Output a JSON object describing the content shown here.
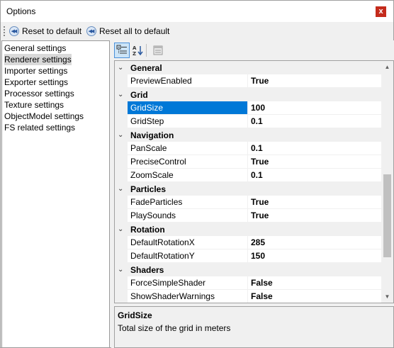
{
  "window": {
    "title": "Options",
    "close_glyph": "x"
  },
  "toolbar": {
    "reset_default": "Reset to default",
    "reset_all_default": "Reset all to default"
  },
  "left_list": [
    {
      "label": "General settings",
      "selected": false
    },
    {
      "label": "Renderer settings",
      "selected": true
    },
    {
      "label": "Importer settings",
      "selected": false
    },
    {
      "label": "Exporter settings",
      "selected": false
    },
    {
      "label": "Processor settings",
      "selected": false
    },
    {
      "label": "Texture settings",
      "selected": false
    },
    {
      "label": "ObjectModel settings",
      "selected": false
    },
    {
      "label": "FS related settings",
      "selected": false
    }
  ],
  "grid_toolbar": {
    "categorized_icon": "categorized-view-icon",
    "alphabetical_icon": "alphabetical-sort-icon",
    "property_pages_icon": "property-pages-icon",
    "active": "categorized"
  },
  "property_grid": [
    {
      "type": "category",
      "label": "General"
    },
    {
      "type": "property",
      "name": "PreviewEnabled",
      "value": "True"
    },
    {
      "type": "category",
      "label": "Grid"
    },
    {
      "type": "property",
      "name": "GridSize",
      "value": "100",
      "selected": true
    },
    {
      "type": "property",
      "name": "GridStep",
      "value": "0.1"
    },
    {
      "type": "category",
      "label": "Navigation"
    },
    {
      "type": "property",
      "name": "PanScale",
      "value": "0.1"
    },
    {
      "type": "property",
      "name": "PreciseControl",
      "value": "True"
    },
    {
      "type": "property",
      "name": "ZoomScale",
      "value": "0.1"
    },
    {
      "type": "category",
      "label": "Particles"
    },
    {
      "type": "property",
      "name": "FadeParticles",
      "value": "True"
    },
    {
      "type": "property",
      "name": "PlaySounds",
      "value": "True"
    },
    {
      "type": "category",
      "label": "Rotation"
    },
    {
      "type": "property",
      "name": "DefaultRotationX",
      "value": "285"
    },
    {
      "type": "property",
      "name": "DefaultRotationY",
      "value": "150"
    },
    {
      "type": "category",
      "label": "Shaders"
    },
    {
      "type": "property",
      "name": "ForceSimpleShader",
      "value": "False"
    },
    {
      "type": "property",
      "name": "ShowShaderWarnings",
      "value": "False"
    }
  ],
  "description": {
    "title": "GridSize",
    "text": "Total size of the grid in meters"
  },
  "colors": {
    "selection": "#0078d7",
    "close_button": "#c42b1c"
  }
}
